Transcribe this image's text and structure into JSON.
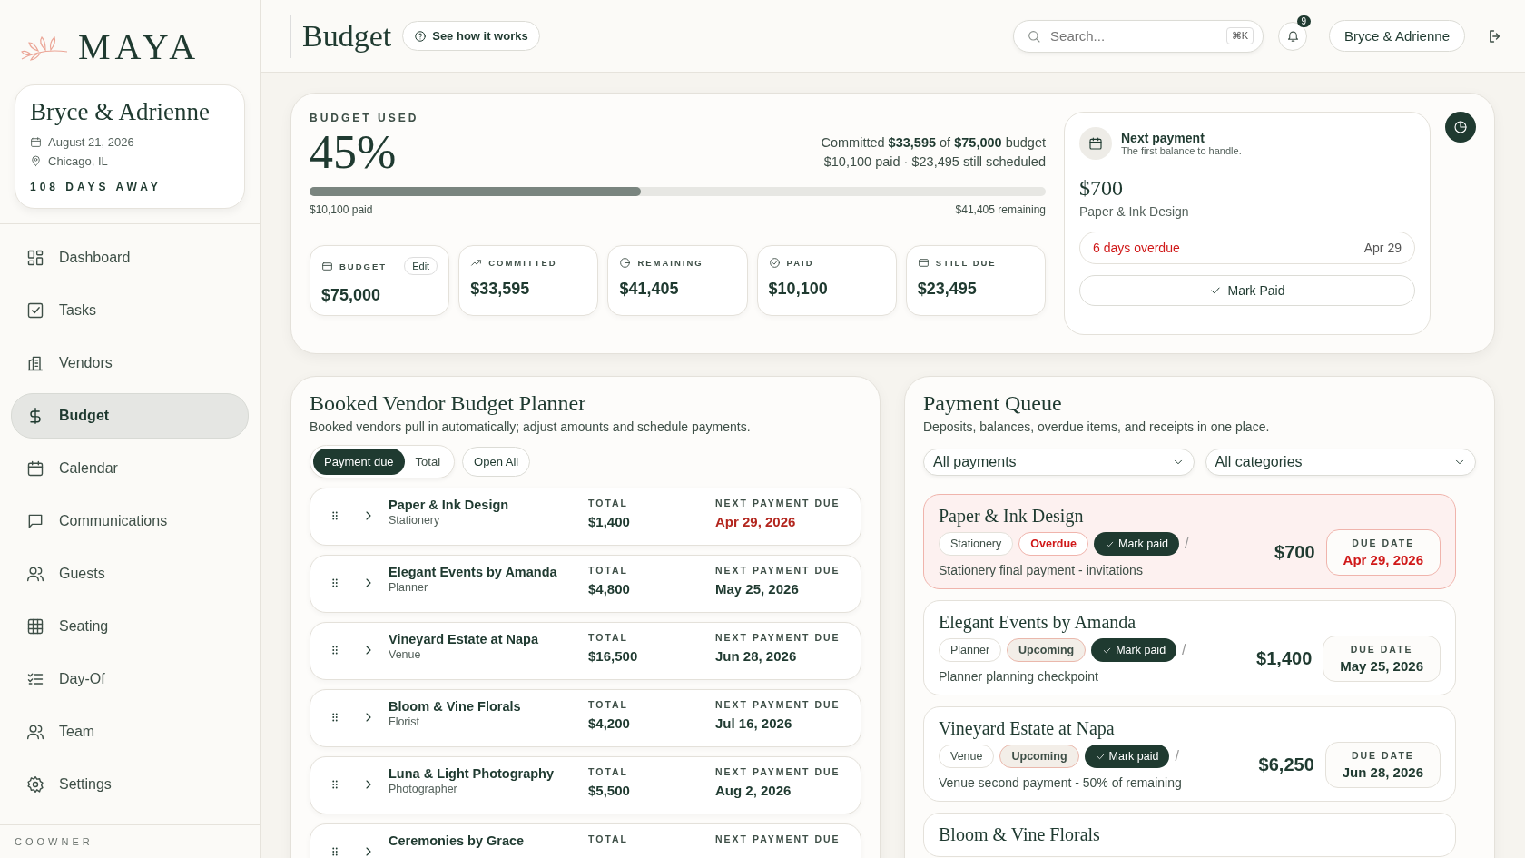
{
  "brand": {
    "name": "MAYA"
  },
  "couple": {
    "names": "Bryce & Adrienne",
    "date": "August 21, 2026",
    "location": "Chicago, IL",
    "countdown": "108 DAYS AWAY"
  },
  "nav": [
    {
      "label": "Dashboard",
      "selected": false
    },
    {
      "label": "Tasks",
      "selected": false
    },
    {
      "label": "Vendors",
      "selected": false
    },
    {
      "label": "Budget",
      "selected": true
    },
    {
      "label": "Calendar",
      "selected": false
    },
    {
      "label": "Communications",
      "selected": false
    },
    {
      "label": "Guests",
      "selected": false
    },
    {
      "label": "Seating",
      "selected": false
    },
    {
      "label": "Day-Of",
      "selected": false
    },
    {
      "label": "Team",
      "selected": false
    },
    {
      "label": "Settings",
      "selected": false
    }
  ],
  "sidebar_footer": "COOWNER",
  "header": {
    "title": "Budget",
    "help_button": "See how it works",
    "search": {
      "placeholder": "Search...",
      "shortcut": "⌘K"
    },
    "notification_count": "9",
    "user_button": "Bryce & Adrienne"
  },
  "budget_used": {
    "label": "BUDGET USED",
    "percent": "45%",
    "summary": "Committed **$33,595** of **$75,000** budget",
    "detail": "$10,100 paid · $23,495 still scheduled",
    "level": 0.45,
    "paid_label": "$10,100 paid",
    "remaining_label": "$41,405 remaining",
    "stats": [
      {
        "label": "BUDGET",
        "value": "$75,000",
        "edit": "Edit"
      },
      {
        "label": "COMMITTED",
        "value": "$33,595"
      },
      {
        "label": "REMAINING",
        "value": "$41,405"
      },
      {
        "label": "PAID",
        "value": "$10,100"
      },
      {
        "label": "STILL DUE",
        "value": "$23,495"
      }
    ]
  },
  "next_payment": {
    "title": "Next payment",
    "subtitle": "The first balance to handle.",
    "amount": "$700",
    "vendor": "Paper & Ink Design",
    "status": "6 days overdue",
    "date": "Apr 29",
    "button": "Mark Paid"
  },
  "planner": {
    "title": "Booked Vendor Budget Planner",
    "subtitle": "Booked vendors pull in automatically; adjust amounts and schedule payments.",
    "toggle": [
      {
        "label": "Payment due",
        "selected": true
      },
      {
        "label": "Total",
        "selected": false
      }
    ],
    "open_all": "Open All",
    "rows": [
      {
        "name": "Paper & Ink Design",
        "category": "Stationery",
        "total_label": "TOTAL",
        "total": "$1,400",
        "due_label": "NEXT PAYMENT DUE",
        "due": "Apr 29, 2026",
        "overdue": true
      },
      {
        "name": "Elegant Events by Amanda",
        "category": "Planner",
        "total_label": "TOTAL",
        "total": "$4,800",
        "due_label": "NEXT PAYMENT DUE",
        "due": "May 25, 2026",
        "overdue": false
      },
      {
        "name": "Vineyard Estate at Napa",
        "category": "Venue",
        "total_label": "TOTAL",
        "total": "$16,500",
        "due_label": "NEXT PAYMENT DUE",
        "due": "Jun 28, 2026",
        "overdue": false
      },
      {
        "name": "Bloom & Vine Florals",
        "category": "Florist",
        "total_label": "TOTAL",
        "total": "$4,200",
        "due_label": "NEXT PAYMENT DUE",
        "due": "Jul 16, 2026",
        "overdue": false
      },
      {
        "name": "Luna & Light Photography",
        "category": "Photographer",
        "total_label": "TOTAL",
        "total": "$5,500",
        "due_label": "NEXT PAYMENT DUE",
        "due": "Aug 2, 2026",
        "overdue": false
      },
      {
        "name": "Ceremonies by Grace",
        "total_label": "TOTAL",
        "due_label": "NEXT PAYMENT DUE"
      }
    ]
  },
  "queue": {
    "title": "Payment Queue",
    "subtitle": "Deposits, balances, overdue items, and receipts in one place.",
    "filters": [
      "All payments",
      "All categories"
    ],
    "items": [
      {
        "name": "Paper & Ink Design",
        "category": "Stationery",
        "status": "Overdue",
        "kind": "overdue",
        "action": "Mark paid",
        "separator": "/",
        "amount": "$700",
        "due_label": "DUE DATE",
        "due": "Apr 29, 2026",
        "note": "Stationery final payment - invitations"
      },
      {
        "name": "Elegant Events by Amanda",
        "category": "Planner",
        "status": "Upcoming",
        "kind": "upcoming",
        "action": "Mark paid",
        "separator": "/",
        "amount": "$1,400",
        "due_label": "DUE DATE",
        "due": "May 25, 2026",
        "note": "Planner planning checkpoint"
      },
      {
        "name": "Vineyard Estate at Napa",
        "category": "Venue",
        "status": "Upcoming",
        "kind": "upcoming",
        "action": "Mark paid",
        "separator": "/",
        "amount": "$6,250",
        "due_label": "DUE DATE",
        "due": "Jun 28, 2026",
        "note": "Venue second payment - 50% of remaining"
      },
      {
        "name": "Bloom & Vine Florals",
        "kind": "upcoming"
      }
    ]
  }
}
